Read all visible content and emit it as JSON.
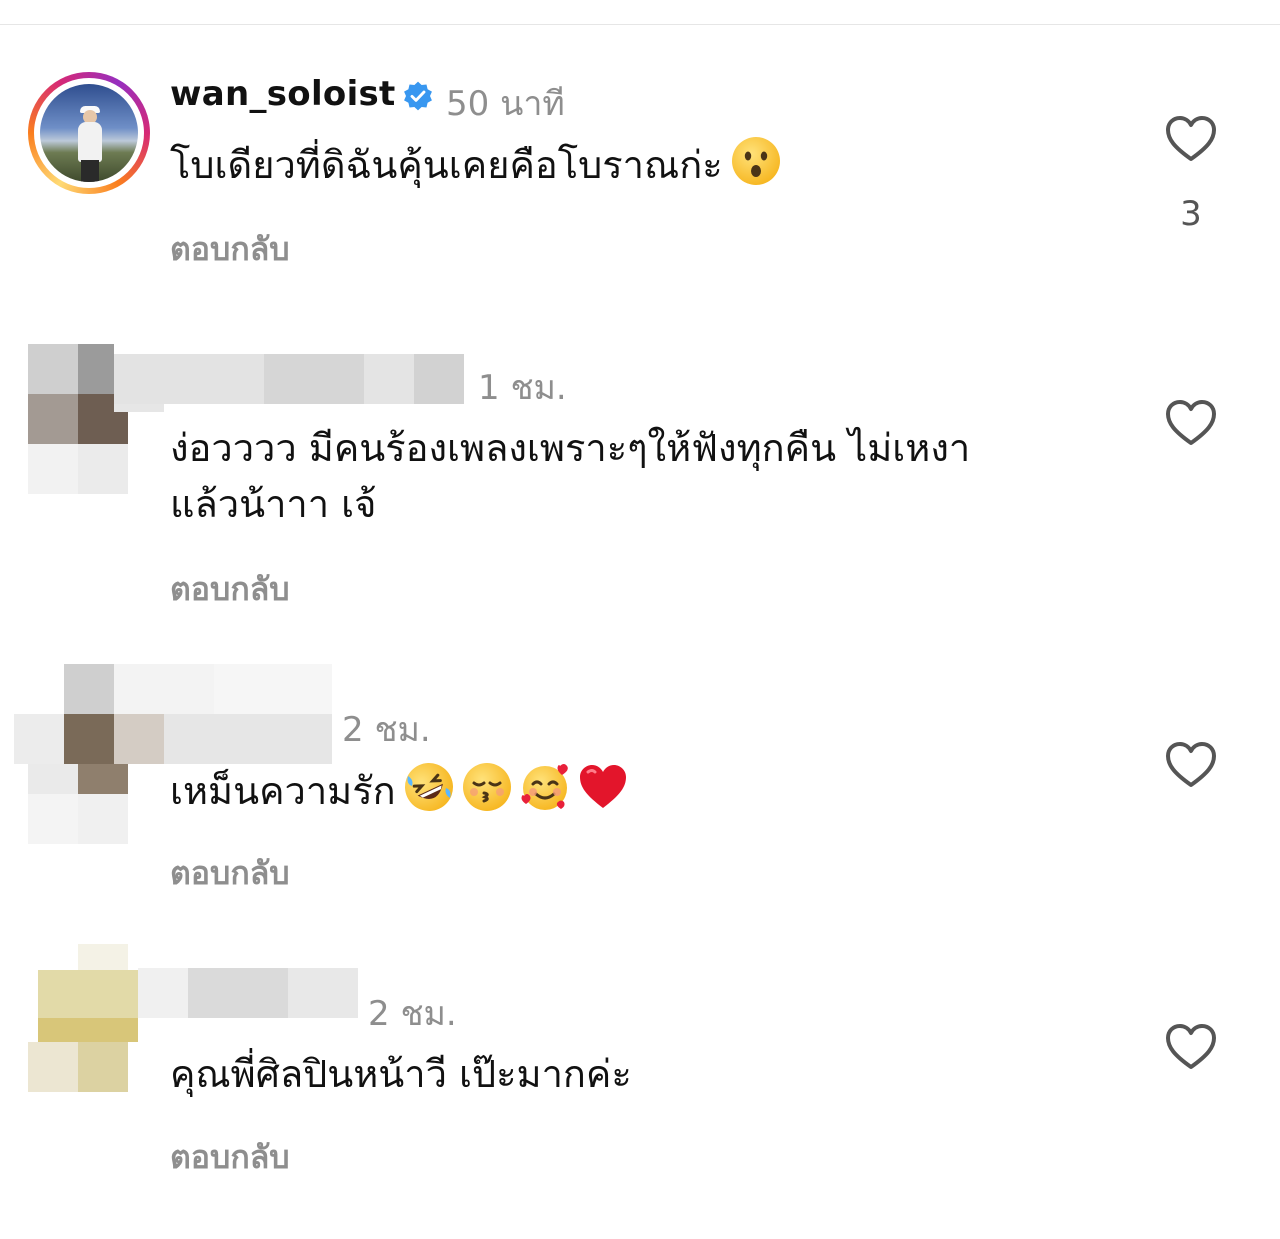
{
  "comments": [
    {
      "username": "wan_soloist",
      "verified": true,
      "time": "50 นาที",
      "text": "โบเดียวที่ดิฉันคุ้นเคยคือโบราณก่ะ",
      "emojis": [
        "astonished-face"
      ],
      "reply_label": "ตอบกลับ",
      "likes": "3"
    },
    {
      "username": "",
      "time": "1 ชม.",
      "text_line1": "ง่อวววว มีคนร้องเพลงเพราะๆให้ฟังทุกคืน ไม่เหงา",
      "text_line2": "แล้วน้าาา เจ้",
      "reply_label": "ตอบกลับ"
    },
    {
      "username": "",
      "time": "2 ชม.",
      "text": "เหม็นความรัก",
      "emojis": [
        "rolling-laughing-face",
        "kissing-closed-eyes-face",
        "smiling-face-with-hearts",
        "red-heart"
      ],
      "reply_label": "ตอบกลับ"
    },
    {
      "username": "",
      "time": "2 ชม.",
      "text": "คุณพี่ศิลปินหน้าวี เป๊ะมากค่ะ",
      "reply_label": "ตอบกลับ"
    }
  ],
  "colors": {
    "verified": "#3897f0",
    "muted": "#8e8e8e",
    "text": "#111111"
  },
  "icons": {
    "like": "heart-outline-icon"
  }
}
